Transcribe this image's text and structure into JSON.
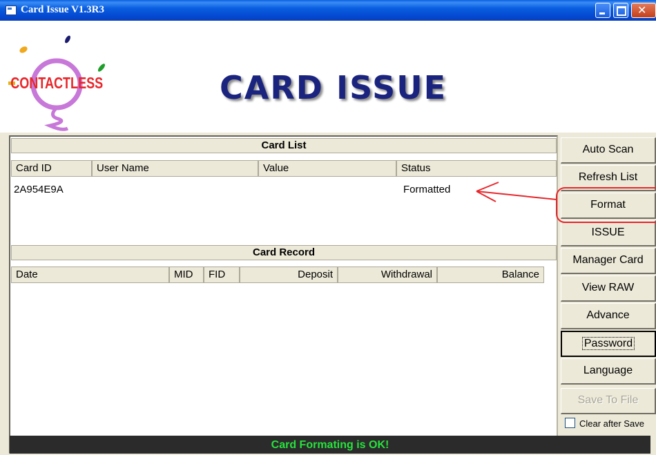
{
  "window": {
    "title": "Card Issue V1.3R3"
  },
  "banner": {
    "logo_text": "CONTACTLESS",
    "title": "CARD ISSUE"
  },
  "card_list": {
    "header": "Card List",
    "columns": [
      "Card ID",
      "User Name",
      "Value",
      "Status"
    ],
    "rows": [
      {
        "card_id": "2A954E9A",
        "user_name": "",
        "value": "",
        "status": "Formatted"
      }
    ]
  },
  "card_record": {
    "header": "Card Record",
    "columns": [
      "Date",
      "MID",
      "FID",
      "Deposit",
      "Withdrawal",
      "Balance"
    ]
  },
  "buttons": {
    "auto_scan": "Auto Scan",
    "refresh_list": "Refresh List",
    "format": "Format",
    "issue": "ISSUE",
    "manager_card": "Manager Card",
    "view_raw": "View RAW",
    "advance": "Advance",
    "password": "Password",
    "language": "Language",
    "save_to_file": "Save To File"
  },
  "clear_after_save": {
    "label": "Clear after Save",
    "checked": false
  },
  "status_bar": "Card Formating is OK!",
  "colors": {
    "annotation": "#e8262b",
    "status_text": "#27e33c",
    "banner_title": "#1a237e"
  }
}
